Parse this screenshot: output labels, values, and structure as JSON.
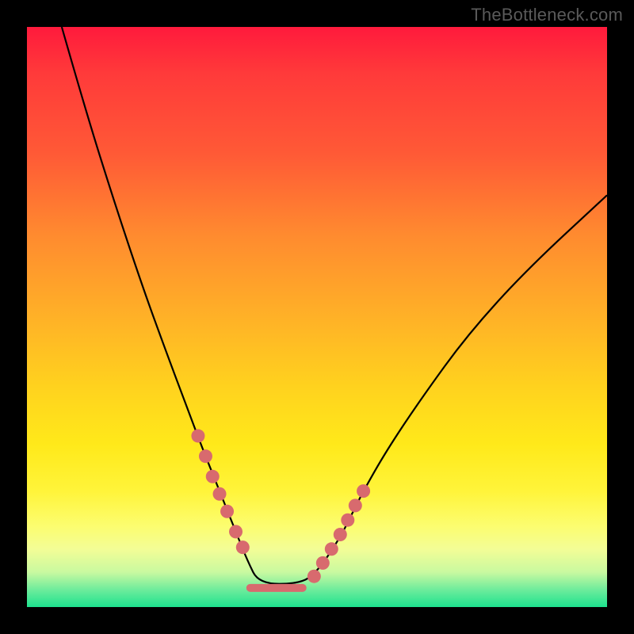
{
  "watermark": "TheBottleneck.com",
  "colors": {
    "frame": "#000000",
    "marker": "#d86a6e",
    "curve": "#000000",
    "gradient_top": "#ff1a3c",
    "gradient_bottom": "#1de28e"
  },
  "chart_data": {
    "type": "line",
    "title": "",
    "xlabel": "",
    "ylabel": "",
    "xlim": [
      0,
      100
    ],
    "ylim": [
      0,
      100
    ],
    "grid": false,
    "legend": false,
    "series": [
      {
        "name": "bottleneck-curve",
        "x": [
          6,
          10,
          15,
          20,
          24,
          27,
          30,
          32,
          34,
          36,
          38,
          40,
          47,
          50,
          54,
          56,
          58,
          62,
          68,
          76,
          86,
          100
        ],
        "y": [
          100,
          86,
          70,
          55,
          44,
          36,
          28,
          23,
          18,
          13,
          8,
          4,
          4,
          6,
          12,
          16,
          20,
          27,
          36,
          47,
          58,
          71
        ]
      }
    ],
    "markers": {
      "name": "highlight-points",
      "x": [
        29.5,
        30.8,
        32,
        33.2,
        34.5,
        36,
        37.2,
        49.5,
        51,
        52.5,
        54,
        55.3,
        56.6,
        58
      ],
      "y": [
        29.5,
        26,
        22.5,
        19.5,
        16.5,
        13,
        10.3,
        5.3,
        7.6,
        10,
        12.5,
        15,
        17.5,
        20
      ]
    },
    "plateau": {
      "name": "minimum-plateau",
      "x": [
        38.5,
        47.5
      ],
      "y": [
        3.3,
        3.3
      ]
    }
  }
}
